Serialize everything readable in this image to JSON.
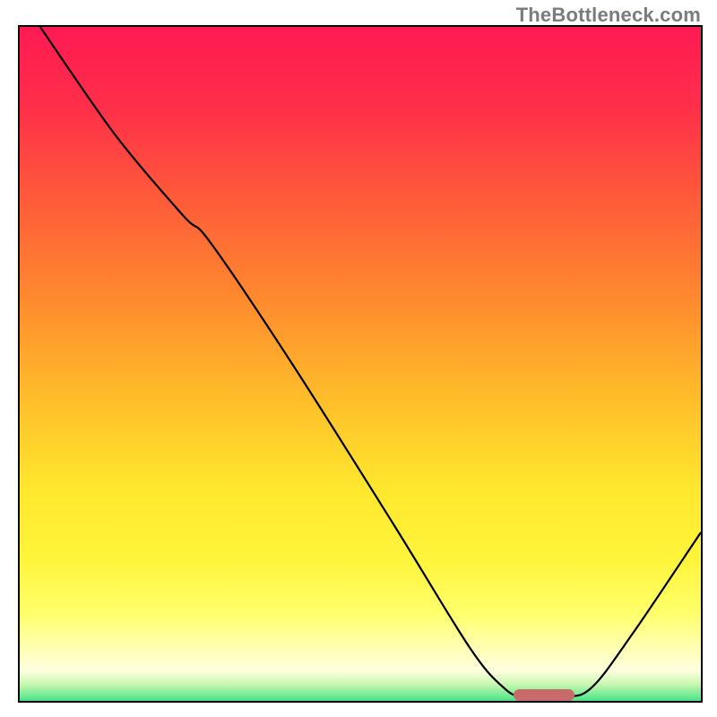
{
  "watermark": "TheBottleneck.com",
  "colors": {
    "border": "#000000",
    "curve": "#000000",
    "marker": "#c86a6a",
    "watermark_text": "#7c7c7c"
  },
  "gradient_stops": [
    {
      "offset": 0.0,
      "color": "#ff1a53"
    },
    {
      "offset": 0.12,
      "color": "#ff2f49"
    },
    {
      "offset": 0.25,
      "color": "#ff5a3a"
    },
    {
      "offset": 0.4,
      "color": "#ff8a2e"
    },
    {
      "offset": 0.55,
      "color": "#ffbf2a"
    },
    {
      "offset": 0.68,
      "color": "#ffe82e"
    },
    {
      "offset": 0.78,
      "color": "#fff43a"
    },
    {
      "offset": 0.86,
      "color": "#ffff6a"
    },
    {
      "offset": 0.91,
      "color": "#ffffb0"
    },
    {
      "offset": 0.945,
      "color": "#ffffe0"
    },
    {
      "offset": 0.965,
      "color": "#c8f7b0"
    },
    {
      "offset": 0.985,
      "color": "#5fe88f"
    },
    {
      "offset": 1.0,
      "color": "#17d164"
    }
  ],
  "chart_data": {
    "type": "line",
    "title": "",
    "xlabel": "",
    "ylabel": "",
    "xlim": [
      0,
      100
    ],
    "ylim": [
      0,
      100
    ],
    "series": [
      {
        "name": "bottleneck-curve",
        "points": [
          {
            "x": 3,
            "y": 100
          },
          {
            "x": 14,
            "y": 84
          },
          {
            "x": 24,
            "y": 72
          },
          {
            "x": 28,
            "y": 68
          },
          {
            "x": 40,
            "y": 50
          },
          {
            "x": 55,
            "y": 26
          },
          {
            "x": 66,
            "y": 8
          },
          {
            "x": 71,
            "y": 2
          },
          {
            "x": 74,
            "y": 0.6
          },
          {
            "x": 80,
            "y": 0.6
          },
          {
            "x": 84,
            "y": 2
          },
          {
            "x": 90,
            "y": 10
          },
          {
            "x": 100,
            "y": 25
          }
        ]
      }
    ],
    "annotations": [
      {
        "name": "optimal-marker",
        "shape": "rounded-bar",
        "x_start": 72.5,
        "x_end": 81.5,
        "y": 0.9,
        "height_pct": 1.7
      }
    ]
  }
}
